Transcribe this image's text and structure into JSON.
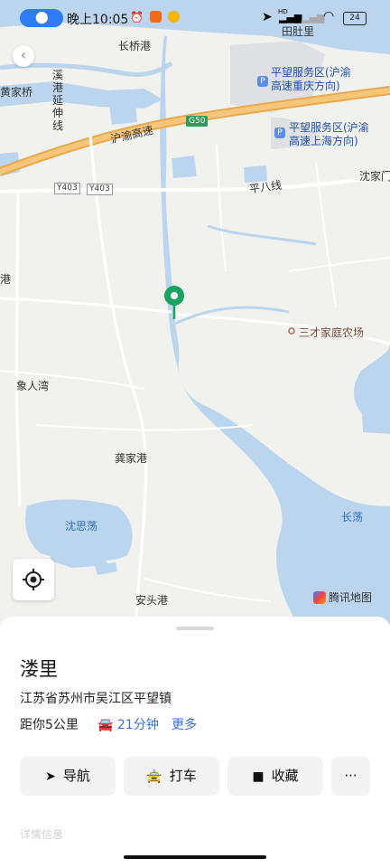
{
  "status_bar": {
    "time": "晚上10:05",
    "battery": "24",
    "network": "HD"
  },
  "map": {
    "brand": "腾讯地图",
    "labels": {
      "changqiaogang": "长桥港",
      "tiandouli": "田肚里",
      "huangjiaqiao": "黄家桥",
      "xigang_1": "溪",
      "xigang_2": "港",
      "xigang_3": "延",
      "xigang_4": "伸",
      "xigang_5": "线",
      "service_cq_1": "平望服务区(沪渝",
      "service_cq_2": "高速重庆方向)",
      "service_sh_1": "平望服务区(沪渝",
      "service_sh_2": "高速上海方向)",
      "huyu": "沪渝高速",
      "g50": "G50",
      "y403a": "Y403",
      "y403b": "Y403",
      "pingbaxian": "平八线",
      "shenjia": "沈家门",
      "gang_left": "港",
      "sancai": "三才家庭农场",
      "xiangrenwan": "象人湾",
      "gongjiagang": "龚家港",
      "shensidang": "沈思荡",
      "changdang": "长荡",
      "antougang": "安头港"
    }
  },
  "place": {
    "name": "溇里",
    "address": "江苏省苏州市吴江区平望镇",
    "distance": "距你5公里",
    "drive_time": "21分钟",
    "more": "更多"
  },
  "actions": {
    "navigate": "导航",
    "taxi": "打车",
    "favorite": "收藏",
    "more": "···"
  },
  "faded_text": "详情信息"
}
